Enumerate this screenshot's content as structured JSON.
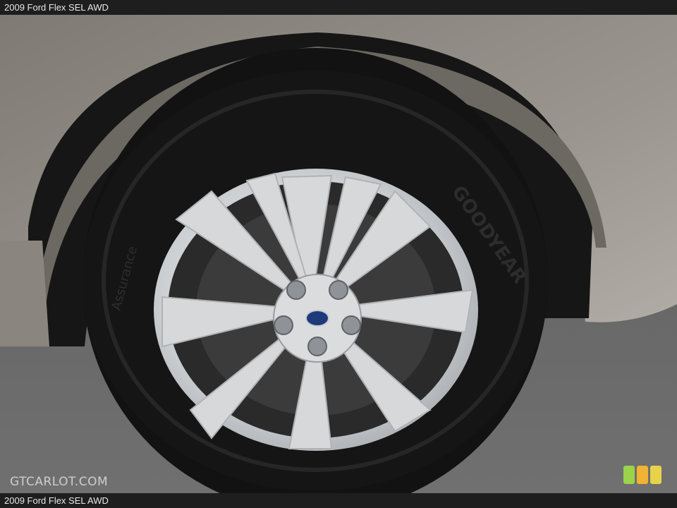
{
  "header": {
    "title": "2009 Ford Flex SEL AWD"
  },
  "footer": {
    "caption": "2009 Ford Flex SEL AWD"
  },
  "watermark": {
    "text": "GTCARLOT.COM"
  },
  "tire": {
    "brand": "GOODYEAR",
    "model": "Assurance"
  },
  "logo_colors": [
    "#9bd34a",
    "#f2b233",
    "#e8d24a"
  ],
  "palette": {
    "body_paint": "#8c877f",
    "tire": "#141414",
    "wheel": "#d4d6d8",
    "asphalt": "#6a6a6a"
  }
}
